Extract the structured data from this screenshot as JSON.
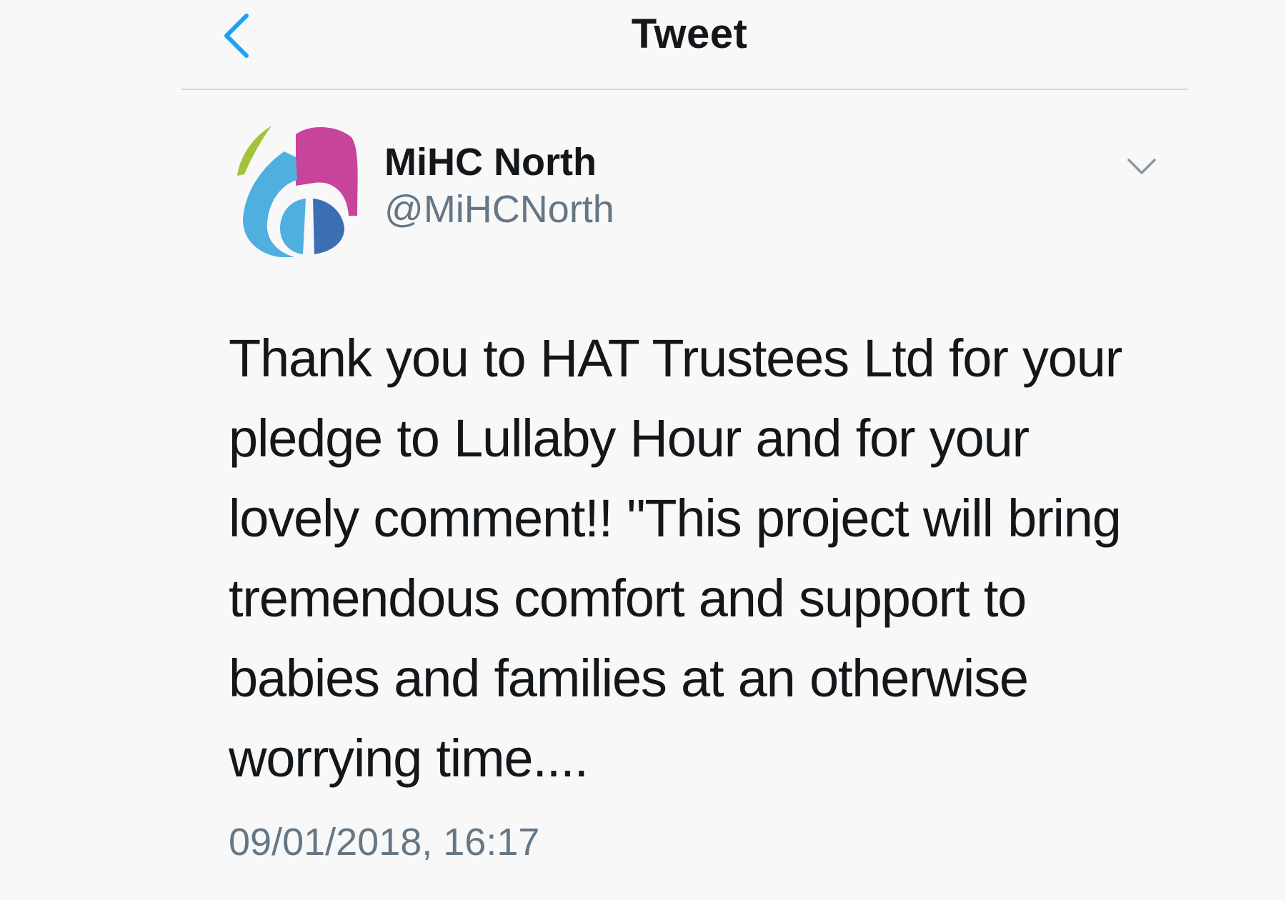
{
  "nav": {
    "back_icon": "chevron-left-icon",
    "title": "Tweet"
  },
  "tweet": {
    "author": {
      "name": "MiHC North",
      "handle": "@MiHCNorth",
      "avatar_colors": [
        "#a2c23a",
        "#c8449b",
        "#4fb0e0",
        "#3b6fb2"
      ]
    },
    "menu_icon": "chevron-down-icon",
    "text": "Thank you to HAT Trustees Ltd for your pledge to Lullaby Hour and for your lovely comment!! \"This project will bring tremendous comfort and support to babies and families at an otherwise worrying time....",
    "timestamp": "09/01/2018, 16:17"
  },
  "colors": {
    "accent": "#1da1f2",
    "text_primary": "#14171a",
    "text_secondary": "#657786",
    "background": "#f8f8f9",
    "divider": "#cfd6dc"
  }
}
